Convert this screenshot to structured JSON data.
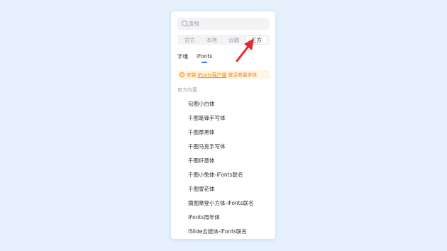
{
  "search": {
    "placeholder": "查找"
  },
  "tabs": [
    {
      "label": "官方",
      "active": false
    },
    {
      "label": "本地",
      "active": false
    },
    {
      "label": "云端",
      "active": false
    },
    {
      "label": "三方",
      "active": true
    }
  ],
  "subtabs": [
    {
      "label": "字魂",
      "active": false
    },
    {
      "label": "iFonts",
      "active": true
    }
  ],
  "notice": {
    "prefix": "安装",
    "link": "iFonts客户端",
    "suffix": "激活商量字体"
  },
  "section_title": "官方内置",
  "fonts": [
    "包图小白体",
    "千图笔锋手写体",
    "千图厚黑体",
    "千图马克手写体",
    "千图纤墨体",
    "千图小兔体-iFonts联名",
    "千图雪花体",
    "摘图摩登小方体-iFonts联名",
    "iFonts周年体",
    "iSlide云统体-iFonts联名"
  ],
  "colors": {
    "accent": "#3d6cf4",
    "warning": "#f08a00",
    "arrow": "#e62a2a"
  }
}
